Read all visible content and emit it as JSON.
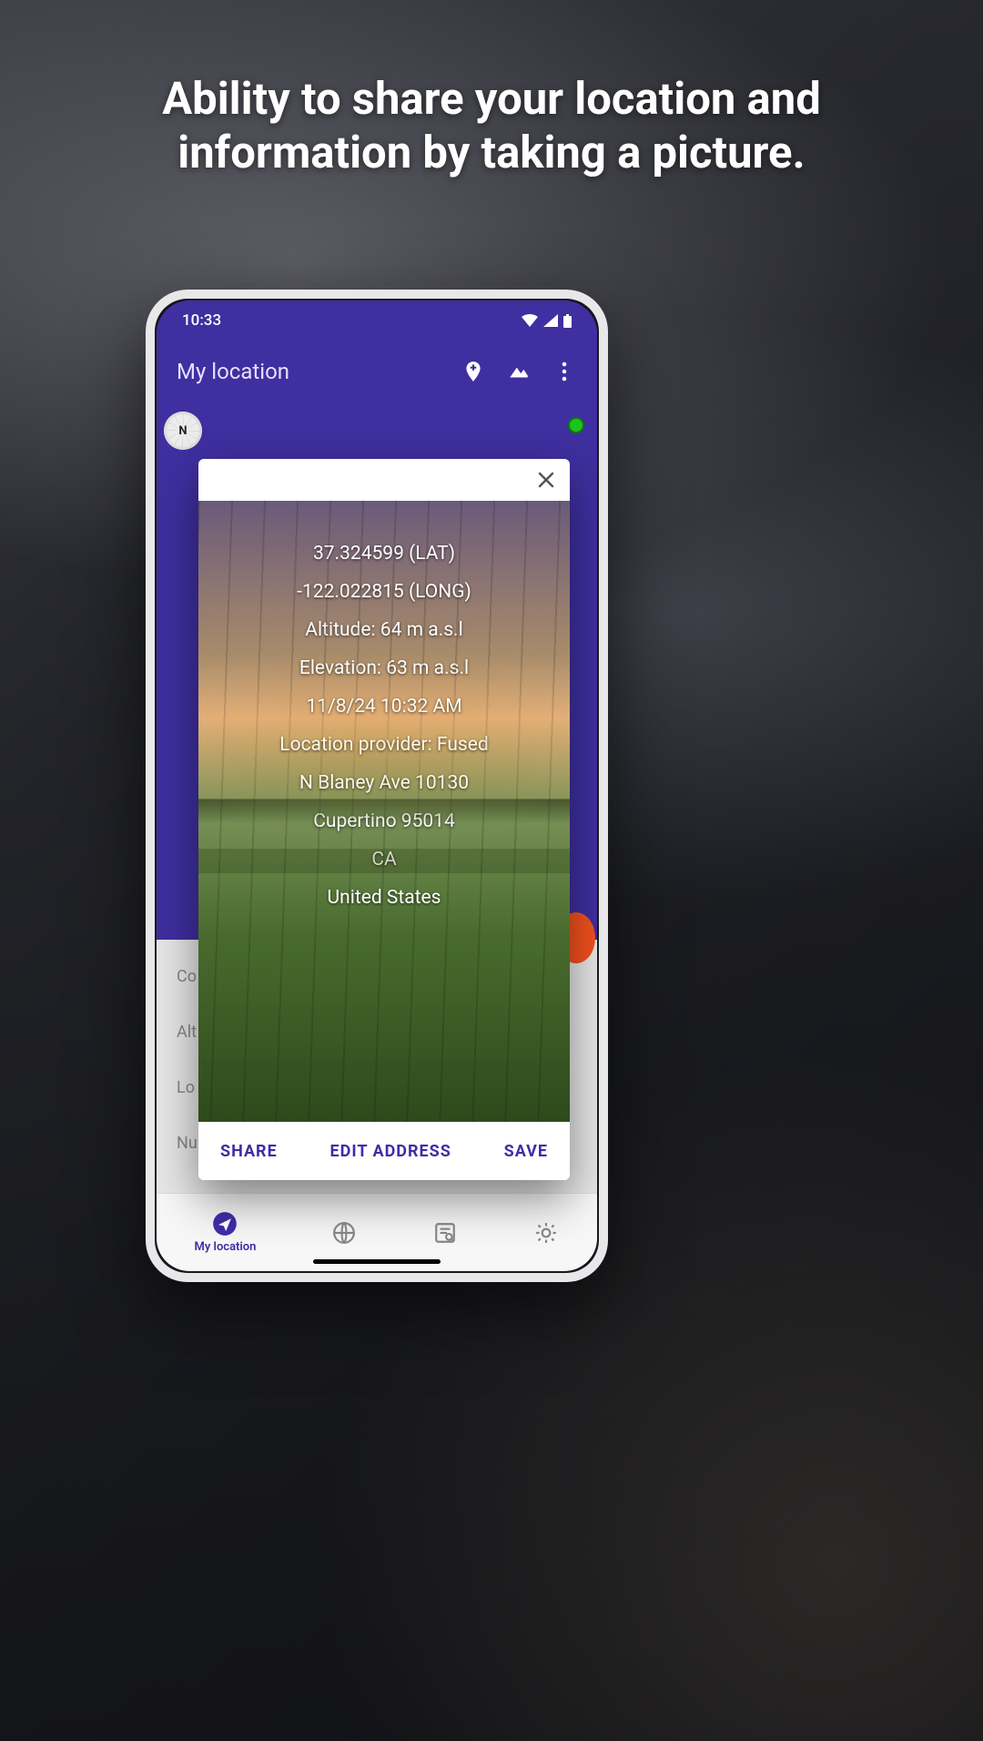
{
  "headline": "Ability to share your location and information by taking a picture.",
  "status": {
    "time": "10:33"
  },
  "appbar": {
    "title": "My location"
  },
  "compass_letter": "N",
  "hidden_labels": [
    "Co",
    "Alt",
    "Lo",
    "Nu"
  ],
  "dialog": {
    "lat": "37.324599 (LAT)",
    "long": "-122.022815 (LONG)",
    "altitude": "Altitude: 64 m a.s.l",
    "elevation": "Elevation: 63 m a.s.l",
    "datetime": "11/8/24 10:32 AM",
    "provider": "Location provider: Fused",
    "street": "N Blaney Ave 10130",
    "city": "Cupertino 95014",
    "state": "CA",
    "country": "United States",
    "actions": {
      "share": "SHARE",
      "edit": "EDIT ADDRESS",
      "save": "SAVE"
    }
  },
  "nav": {
    "mylocation": "My location"
  }
}
